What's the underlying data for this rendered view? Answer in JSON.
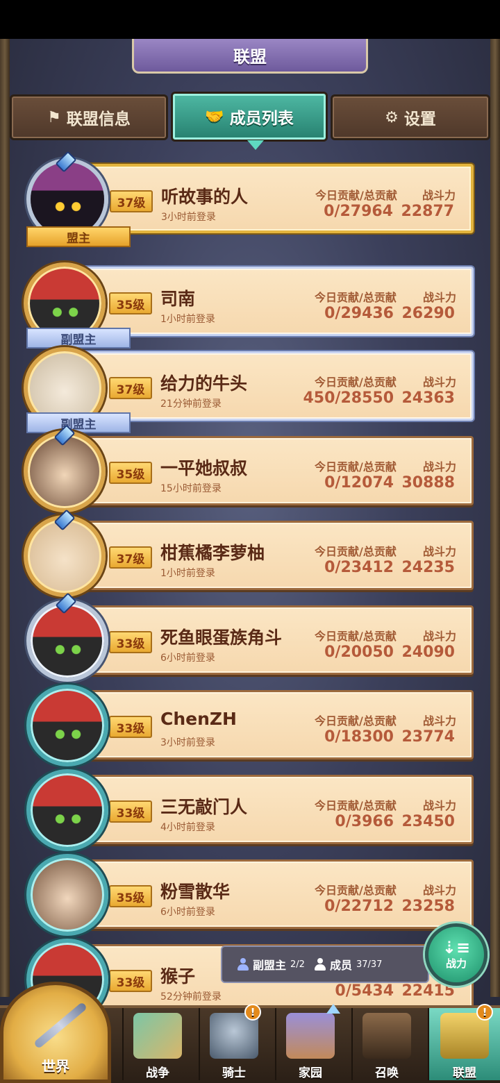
{
  "header": {
    "title": "联盟"
  },
  "tabs": [
    {
      "label": "联盟信息",
      "icon": "flag-icon"
    },
    {
      "label": "成员列表",
      "icon": "handshake-icon"
    },
    {
      "label": "设置",
      "icon": "gear-icon"
    }
  ],
  "labels": {
    "contribution": "今日贡献/总贡献",
    "power": "战斗力"
  },
  "roles": {
    "leader": "盟主",
    "vice": "副盟主"
  },
  "members": [
    {
      "level": "37级",
      "name": "听故事的人",
      "login": "3小时前登录",
      "contribution": "0/27964",
      "power": "22877",
      "role": "盟主"
    },
    {
      "level": "35级",
      "name": "司南",
      "login": "1小时前登录",
      "contribution": "0/29436",
      "power": "26290",
      "role": "副盟主"
    },
    {
      "level": "37级",
      "name": "给力的牛头",
      "login": "21分钟前登录",
      "contribution": "450/28550",
      "power": "24363",
      "role": "副盟主"
    },
    {
      "level": "35级",
      "name": "一平她叔叔",
      "login": "15小时前登录",
      "contribution": "0/12074",
      "power": "30888",
      "role": ""
    },
    {
      "level": "37级",
      "name": "柑蕉橘李萝柚",
      "login": "1小时前登录",
      "contribution": "0/23412",
      "power": "24235",
      "role": ""
    },
    {
      "level": "33级",
      "name": "死鱼眼蛋族角斗",
      "login": "6小时前登录",
      "contribution": "0/20050",
      "power": "24090",
      "role": ""
    },
    {
      "level": "33级",
      "name": "ChenZH",
      "login": "3小时前登录",
      "contribution": "0/18300",
      "power": "23774",
      "role": ""
    },
    {
      "level": "33级",
      "name": "三无敲门人",
      "login": "4小时前登录",
      "contribution": "0/3966",
      "power": "23450",
      "role": ""
    },
    {
      "level": "35级",
      "name": "粉雪散华",
      "login": "6小时前登录",
      "contribution": "0/22712",
      "power": "23258",
      "role": ""
    },
    {
      "level": "33级",
      "name": "猴子",
      "login": "52分钟前登录",
      "contribution": "0/5434",
      "power": "22415",
      "role": ""
    }
  ],
  "stats": {
    "vice_label": "副盟主",
    "vice_count": "2/2",
    "member_label": "成员",
    "member_count": "37/37"
  },
  "power_button": {
    "label": "战力"
  },
  "nav": [
    {
      "label": "世界"
    },
    {
      "label": "战争"
    },
    {
      "label": "骑士",
      "badge": "!"
    },
    {
      "label": "家园"
    },
    {
      "label": "召唤"
    },
    {
      "label": "联盟",
      "badge": "!"
    }
  ],
  "colors": {
    "accent_teal": "#2c8c78",
    "row_bg": "#f6d8ae",
    "level_gold": "#e9a931"
  }
}
